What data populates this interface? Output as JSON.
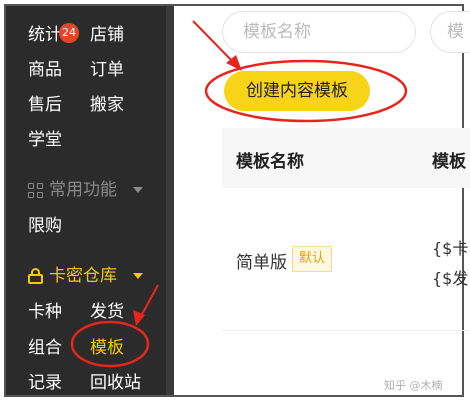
{
  "sidebar": {
    "row1": {
      "left": "统计",
      "right": "店铺"
    },
    "row2": {
      "left": "商品",
      "right": "订单",
      "badge": "24"
    },
    "row3": {
      "left": "售后",
      "right": "搬家"
    },
    "row4": {
      "left": "学堂"
    },
    "common_section": {
      "label": "常用功能",
      "icon": "grid-icon"
    },
    "row5": {
      "left": "限购"
    },
    "card_section": {
      "label": "卡密仓库",
      "icon": "lock-icon"
    },
    "row6": {
      "left": "卡种",
      "right": "发货"
    },
    "row7": {
      "left": "组合",
      "right": "模板"
    },
    "row8": {
      "left": "记录",
      "right": "回收站"
    }
  },
  "toolbar": {
    "search_placeholder": "模板名称",
    "search2_placeholder": "模",
    "create_button": "创建内容模板"
  },
  "table": {
    "headers": [
      "模板名称",
      "模板"
    ],
    "rows": [
      {
        "name": "简单版",
        "tag": "默认",
        "var1": "{$卡",
        "var2": "{$发"
      }
    ]
  },
  "watermark": "知乎 @木楠",
  "colors": {
    "sidebar_bg": "#2b2b2b",
    "accent_yellow": "#f7d418",
    "annotation_red": "#e8251c",
    "badge_red": "#e8432e"
  }
}
